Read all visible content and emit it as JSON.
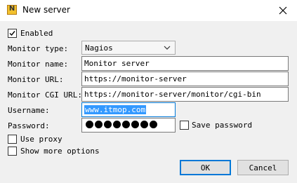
{
  "window": {
    "title": "New server",
    "icon_glyph": "N",
    "icon": "nagios-app-icon",
    "close_icon": "close-icon"
  },
  "enabled": {
    "label": "Enabled",
    "checked": true
  },
  "monitor_type": {
    "label": "Monitor type:",
    "value": "Nagios"
  },
  "monitor_name": {
    "label": "Monitor name:",
    "value": "Monitor server"
  },
  "monitor_url": {
    "label": "Monitor URL:",
    "value": "https://monitor-server"
  },
  "monitor_cgi_url": {
    "label": "Monitor CGI URL:",
    "value": "https://monitor-server/monitor/cgi-bin"
  },
  "username": {
    "label": "Username:",
    "value": "www.itmop.com",
    "selected": true
  },
  "password": {
    "label": "Password:",
    "masked_length": 8
  },
  "save_password": {
    "label": "Save password",
    "checked": false
  },
  "use_proxy": {
    "label": "Use proxy",
    "checked": false
  },
  "show_more": {
    "label": "Show more options",
    "checked": false
  },
  "buttons": {
    "ok": "OK",
    "cancel": "Cancel"
  },
  "colors": {
    "accent": "#0078d7",
    "selection": "#3399ff",
    "dialog_bg": "#f0f0f0"
  }
}
